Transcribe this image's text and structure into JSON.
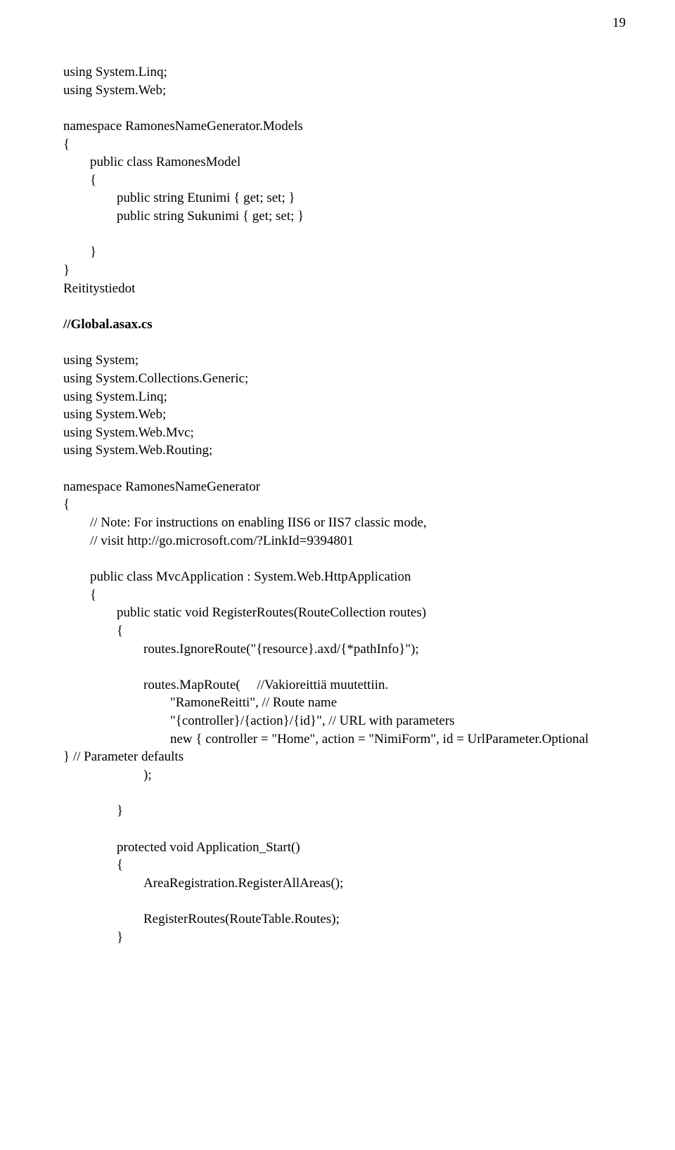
{
  "pageNumber": "19",
  "lines": [
    {
      "text": "using System.Linq;",
      "indent": 0,
      "bold": false,
      "blank": false
    },
    {
      "text": "using System.Web;",
      "indent": 0,
      "bold": false,
      "blank": false
    },
    {
      "text": "",
      "indent": 0,
      "bold": false,
      "blank": true
    },
    {
      "text": "namespace RamonesNameGenerator.Models",
      "indent": 0,
      "bold": false,
      "blank": false
    },
    {
      "text": "{",
      "indent": 0,
      "bold": false,
      "blank": false
    },
    {
      "text": "public class RamonesModel",
      "indent": 1,
      "bold": false,
      "blank": false
    },
    {
      "text": "{",
      "indent": 1,
      "bold": false,
      "blank": false
    },
    {
      "text": "public string Etunimi { get; set; }",
      "indent": 2,
      "bold": false,
      "blank": false
    },
    {
      "text": "public string Sukunimi { get; set; }",
      "indent": 2,
      "bold": false,
      "blank": false
    },
    {
      "text": "",
      "indent": 0,
      "bold": false,
      "blank": true
    },
    {
      "text": "}",
      "indent": 1,
      "bold": false,
      "blank": false
    },
    {
      "text": "}",
      "indent": 0,
      "bold": false,
      "blank": false
    },
    {
      "text": "Reititystiedot",
      "indent": 0,
      "bold": false,
      "blank": false
    },
    {
      "text": "",
      "indent": 0,
      "bold": false,
      "blank": true
    },
    {
      "text": "//Global.asax.cs",
      "indent": 0,
      "bold": true,
      "blank": false
    },
    {
      "text": "",
      "indent": 0,
      "bold": false,
      "blank": true
    },
    {
      "text": "using System;",
      "indent": 0,
      "bold": false,
      "blank": false
    },
    {
      "text": "using System.Collections.Generic;",
      "indent": 0,
      "bold": false,
      "blank": false
    },
    {
      "text": "using System.Linq;",
      "indent": 0,
      "bold": false,
      "blank": false
    },
    {
      "text": "using System.Web;",
      "indent": 0,
      "bold": false,
      "blank": false
    },
    {
      "text": "using System.Web.Mvc;",
      "indent": 0,
      "bold": false,
      "blank": false
    },
    {
      "text": "using System.Web.Routing;",
      "indent": 0,
      "bold": false,
      "blank": false
    },
    {
      "text": "",
      "indent": 0,
      "bold": false,
      "blank": true
    },
    {
      "text": "namespace RamonesNameGenerator",
      "indent": 0,
      "bold": false,
      "blank": false
    },
    {
      "text": "{",
      "indent": 0,
      "bold": false,
      "blank": false
    },
    {
      "text": "// Note: For instructions on enabling IIS6 or IIS7 classic mode,",
      "indent": 1,
      "bold": false,
      "blank": false
    },
    {
      "text": "// visit http://go.microsoft.com/?LinkId=9394801",
      "indent": 1,
      "bold": false,
      "blank": false
    },
    {
      "text": "",
      "indent": 0,
      "bold": false,
      "blank": true
    },
    {
      "text": "public class MvcApplication : System.Web.HttpApplication",
      "indent": 1,
      "bold": false,
      "blank": false
    },
    {
      "text": "{",
      "indent": 1,
      "bold": false,
      "blank": false
    },
    {
      "text": "public static void RegisterRoutes(RouteCollection routes)",
      "indent": 2,
      "bold": false,
      "blank": false
    },
    {
      "text": "{",
      "indent": 2,
      "bold": false,
      "blank": false
    },
    {
      "text": "routes.IgnoreRoute(\"{resource}.axd/{*pathInfo}\");",
      "indent": 3,
      "bold": false,
      "blank": false
    },
    {
      "text": "",
      "indent": 0,
      "bold": false,
      "blank": true
    },
    {
      "text": "routes.MapRoute(     //Vakioreittiä muutettiin.",
      "indent": 3,
      "bold": false,
      "blank": false
    },
    {
      "text": "\"RamoneReitti\", // Route name",
      "indent": 4,
      "bold": false,
      "blank": false
    },
    {
      "text": "\"{controller}/{action}/{id}\", // URL with parameters",
      "indent": 4,
      "bold": false,
      "blank": false
    },
    {
      "text": "new { controller = \"Home\", action = \"NimiForm\", id = UrlParameter.Optional",
      "indent": 4,
      "bold": false,
      "blank": false
    },
    {
      "text": "} // Parameter defaults",
      "indent": 0,
      "bold": false,
      "blank": false
    },
    {
      "text": ");",
      "indent": 3,
      "bold": false,
      "blank": false
    },
    {
      "text": "",
      "indent": 0,
      "bold": false,
      "blank": true
    },
    {
      "text": "}",
      "indent": 2,
      "bold": false,
      "blank": false
    },
    {
      "text": "",
      "indent": 0,
      "bold": false,
      "blank": true
    },
    {
      "text": "protected void Application_Start()",
      "indent": 2,
      "bold": false,
      "blank": false
    },
    {
      "text": "{",
      "indent": 2,
      "bold": false,
      "blank": false
    },
    {
      "text": "AreaRegistration.RegisterAllAreas();",
      "indent": 3,
      "bold": false,
      "blank": false
    },
    {
      "text": "",
      "indent": 0,
      "bold": false,
      "blank": true
    },
    {
      "text": "RegisterRoutes(RouteTable.Routes);",
      "indent": 3,
      "bold": false,
      "blank": false
    },
    {
      "text": "}",
      "indent": 2,
      "bold": false,
      "blank": false
    }
  ]
}
